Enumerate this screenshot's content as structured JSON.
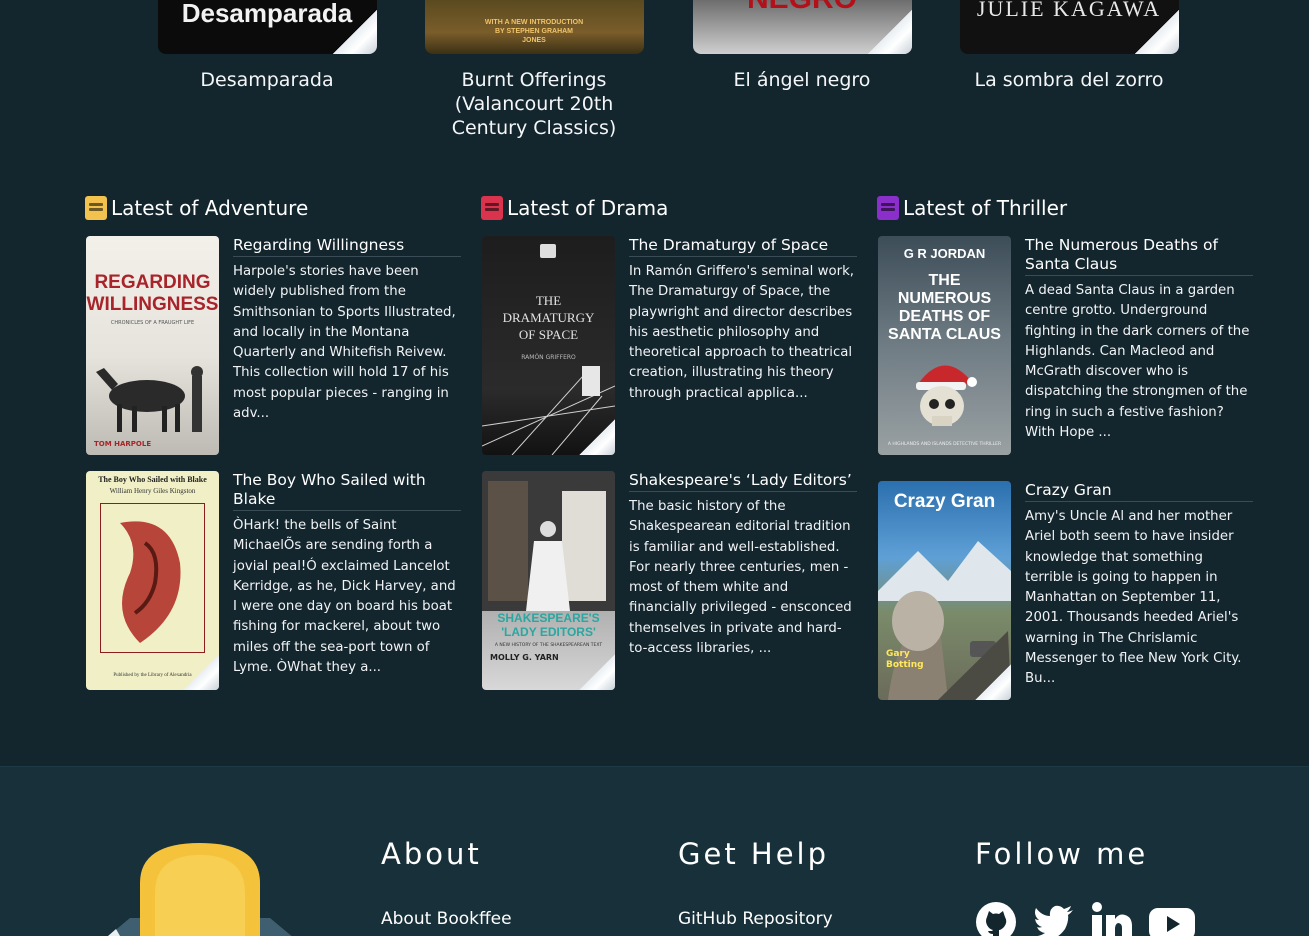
{
  "top_books": [
    {
      "title": "Desamparada",
      "cover_text": "Desamparada"
    },
    {
      "title": "Burnt Offerings (Valancourt 20th Century Classics)",
      "cover_text": "WITH A NEW INTRODUCTION BY STEPHEN GRAHAM JONES"
    },
    {
      "title": "El ángel negro",
      "cover_text": "NEGRO"
    },
    {
      "title": "La sombra del zorro",
      "cover_text": "JULIE KAGAWA"
    }
  ],
  "sections": [
    {
      "title": "Latest of Adventure",
      "icon_color": "#f2c14e",
      "books": [
        {
          "title": "Regarding Willingness",
          "description": "Harpole's stories have been widely published from the Smithsonian to Sports Illustrated, and locally in the Montana Quarterly and Whitefish Reivew. This collection will hold 17 of his most popular pieces - ranging in adv...",
          "cover": {
            "title": "REGARDING WILLINGNESS",
            "subtitle": "CHRONICLES OF A FRAUGHT LIFE",
            "author": "TOM HARPOLE"
          }
        },
        {
          "title": "The Boy Who Sailed with Blake",
          "description": "ÒHark! the bells of Saint MichaelÕs are sending forth a jovial peal!Ó exclaimed Lancelot Kerridge, as he, Dick Harvey, and I were one day on board his boat fishing for mackerel, about two miles off the sea-port town of Lyme. ÒWhat they a...",
          "cover": {
            "title": "The Boy Who Sailed with Blake",
            "author": "William Henry Giles Kingston",
            "footer": "Published by the Library of Alexandria"
          }
        }
      ]
    },
    {
      "title": "Latest of Drama",
      "icon_color": "#d9334d",
      "books": [
        {
          "title": "The Dramaturgy of Space",
          "description": "In Ramón Griffero's seminal work, The Dramaturgy of Space, the playwright and director describes his aesthetic philosophy and theoretical approach to theatrical creation, illustrating his theory through practical applica...",
          "cover": {
            "title": "THE DRAMATURGY OF SPACE",
            "author": "RAMÓN GRIFFERO"
          }
        },
        {
          "title": "Shakespeare's ‘Lady Editors’",
          "description": "The basic history of the Shakespearean editorial tradition is familiar and well-established. For nearly three centuries, men - most of them white and financially privileged - ensconced themselves in private and hard-to-access libraries, ...",
          "cover": {
            "title": "SHAKESPEARE'S 'LADY EDITORS'",
            "subtitle": "A NEW HISTORY OF THE SHAKESPEAREAN TEXT",
            "author": "MOLLY G. YARN"
          }
        }
      ]
    },
    {
      "title": "Latest of Thriller",
      "icon_color": "#8a2fc9",
      "books": [
        {
          "title": "The Numerous Deaths of Santa Claus",
          "description": "A dead Santa Claus in a garden centre grotto. Underground fighting in the dark corners of the Highlands. Can Macleod and McGrath discover who is dispatching the strongmen of the ring in such a festive fashion? With Hope ...",
          "cover": {
            "author": "G R JORDAN",
            "title": "THE NUMEROUS DEATHS OF SANTA CLAUS",
            "footer": "A HIGHLANDS AND ISLANDS DETECTIVE THRILLER"
          }
        },
        {
          "title": "Crazy Gran",
          "description": "Amy's Uncle Al and her mother Ariel both seem to have insider knowledge that something terrible is going to happen in Manhattan on September 11, 2001. Thousands heeded Ariel's warning in The Chrislamic Messenger to flee New York City. Bu...",
          "cover": {
            "title": "Crazy Gran",
            "author": "Gary Botting"
          }
        }
      ]
    }
  ],
  "footer": {
    "about": {
      "heading": "About",
      "link": "About Bookffee"
    },
    "help": {
      "heading": "Get Help",
      "link": "GitHub Repository"
    },
    "follow": {
      "heading": "Follow me",
      "icons": [
        "github-icon",
        "twitter-icon",
        "linkedin-icon",
        "youtube-icon"
      ]
    },
    "logo": "skull-logo"
  }
}
